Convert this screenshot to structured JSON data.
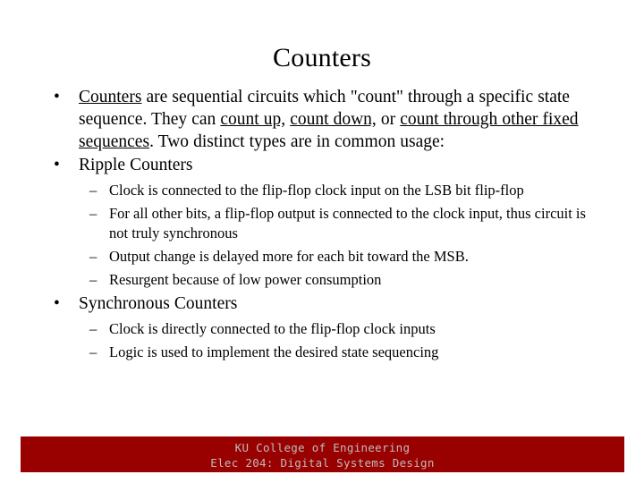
{
  "slide": {
    "title": "Counters",
    "bullets": [
      {
        "level": 1,
        "marker": "•",
        "runs": [
          {
            "text": "Counters",
            "underline": true
          },
          {
            "text": " are sequential circuits which \"count\" through a specific state sequence.  They can ",
            "underline": false
          },
          {
            "text": "count up,",
            "underline": true
          },
          {
            "text": " ",
            "underline": false
          },
          {
            "text": "count down,",
            "underline": true
          },
          {
            "text": " or ",
            "underline": false
          },
          {
            "text": "count through other fixed sequences",
            "underline": true
          },
          {
            "text": ".  Two distinct types are in common usage:",
            "underline": false
          }
        ]
      },
      {
        "level": 1,
        "marker": "•",
        "runs": [
          {
            "text": "Ripple Counters",
            "underline": false
          }
        ]
      },
      {
        "level": 2,
        "marker": "–",
        "runs": [
          {
            "text": "Clock is connected to the flip-flop clock input on the LSB bit flip-flop",
            "underline": false
          }
        ]
      },
      {
        "level": 2,
        "marker": "–",
        "runs": [
          {
            "text": "For all other bits, a flip-flop output is connected to the clock input, thus circuit is not truly synchronous",
            "underline": false
          }
        ]
      },
      {
        "level": 2,
        "marker": "–",
        "runs": [
          {
            "text": "Output change is delayed more for each bit toward the MSB.",
            "underline": false
          }
        ]
      },
      {
        "level": 2,
        "marker": "–",
        "runs": [
          {
            "text": "Resurgent because of low power consumption",
            "underline": false
          }
        ]
      },
      {
        "level": 1,
        "marker": "•",
        "runs": [
          {
            "text": "Synchronous Counters",
            "underline": false
          }
        ]
      },
      {
        "level": 2,
        "marker": "–",
        "runs": [
          {
            "text": "Clock is directly connected to the flip-flop clock inputs",
            "underline": false
          }
        ]
      },
      {
        "level": 2,
        "marker": "–",
        "runs": [
          {
            "text": "Logic is used to implement the desired state sequencing",
            "underline": false
          }
        ]
      }
    ]
  },
  "footer": {
    "line1": "KU College of Engineering",
    "line2": "Elec 204: Digital Systems Design",
    "background_color": "#990000",
    "text_color": "#bdbdbd"
  }
}
